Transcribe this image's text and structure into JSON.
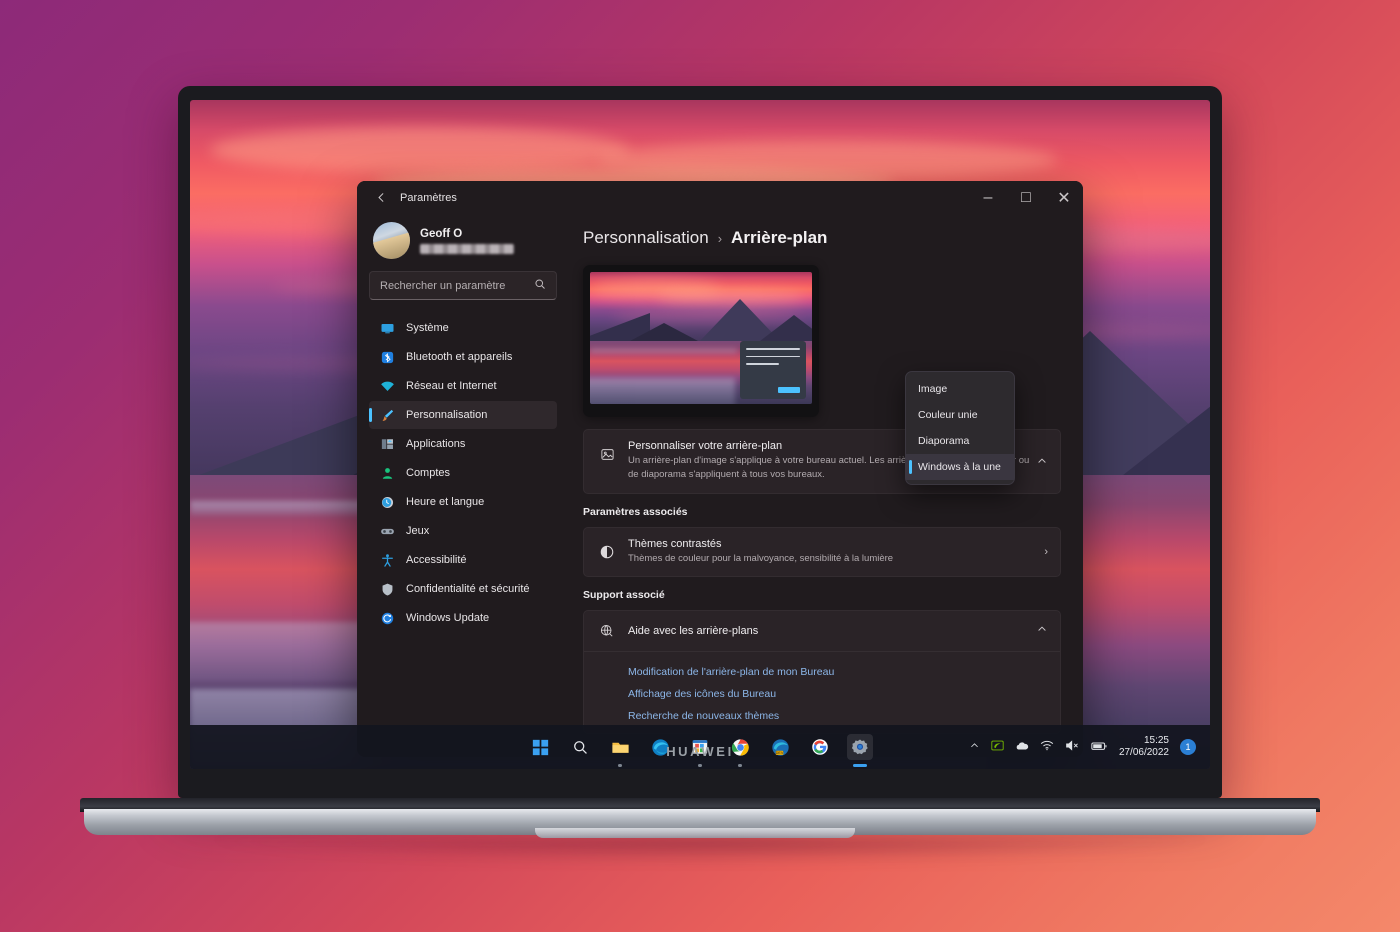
{
  "scene": {
    "device_brand": "HUAWEI",
    "background_gradient": [
      "#8d2a79",
      "#d4495a",
      "#f4886a"
    ]
  },
  "window": {
    "app_title": "Paramètres",
    "back_icon": "back-arrow-icon",
    "controls": {
      "minimize": "–",
      "maximize": "□",
      "close": "✕"
    }
  },
  "sidebar": {
    "profile": {
      "name": "Geoff O",
      "email_redacted": true
    },
    "search": {
      "placeholder": "Rechercher un paramètre",
      "value": "",
      "icon": "search-icon"
    },
    "items": [
      {
        "label": "Système",
        "icon": "monitor-icon",
        "color": "#2d9fe0",
        "selected": false
      },
      {
        "label": "Bluetooth et appareils",
        "icon": "bluetooth-icon",
        "color": "#1f7fe0",
        "selected": false
      },
      {
        "label": "Réseau et Internet",
        "icon": "wifi-icon",
        "color": "#1fb2d8",
        "selected": false
      },
      {
        "label": "Personnalisation",
        "icon": "paintbrush-icon",
        "color": "#4cc2ff",
        "selected": true
      },
      {
        "label": "Applications",
        "icon": "apps-icon",
        "color": "#8fa3b8",
        "selected": false
      },
      {
        "label": "Comptes",
        "icon": "person-icon",
        "color": "#19c37d",
        "selected": false
      },
      {
        "label": "Heure et langue",
        "icon": "clock-icon",
        "color": "#2d9fe0",
        "selected": false
      },
      {
        "label": "Jeux",
        "icon": "gamepad-icon",
        "color": "#9aa4b0",
        "selected": false
      },
      {
        "label": "Accessibilité",
        "icon": "accessibility-icon",
        "color": "#2d9fe0",
        "selected": false
      },
      {
        "label": "Confidentialité et sécurité",
        "icon": "shield-icon",
        "color": "#b8c0c8",
        "selected": false
      },
      {
        "label": "Windows Update",
        "icon": "update-icon",
        "color": "#1f7fe0",
        "selected": false
      }
    ]
  },
  "content": {
    "breadcrumb": {
      "parent": "Personnalisation",
      "separator": "›",
      "current": "Arrière-plan"
    },
    "preview": {
      "name": "desktop-preview-monitor"
    },
    "background_card": {
      "icon": "image-icon",
      "title": "Personnaliser votre arrière-plan",
      "description": "Un arrière-plan d'image s'applique à votre bureau actuel. Les arrière-plans de couleur unifier ou de diaporama s'appliquent à tous vos bureaux.",
      "expand_icon": "chevron-up-icon"
    },
    "dropdown": {
      "open": true,
      "selected": "Windows à la une",
      "options": [
        "Image",
        "Couleur unie",
        "Diaporama",
        "Windows à la une"
      ]
    },
    "related_settings": {
      "label": "Paramètres associés",
      "rows": [
        {
          "icon": "contrast-icon",
          "title": "Thèmes contrastés",
          "subtitle": "Thèmes de couleur pour la malvoyance, sensibilité à la lumière",
          "chevron": "›"
        }
      ]
    },
    "related_support": {
      "label": "Support associé",
      "header": {
        "icon": "globe-help-icon",
        "title": "Aide avec les arrière-plans",
        "expand_icon": "chevron-up-icon"
      },
      "links": [
        "Modification de l'arrière-plan de mon Bureau",
        "Affichage des icônes du Bureau",
        "Recherche de nouveaux thèmes"
      ]
    }
  },
  "taskbar": {
    "icons": [
      {
        "name": "start-icon",
        "label": "Start"
      },
      {
        "name": "search-icon",
        "label": "Recherche"
      },
      {
        "name": "file-explorer-icon",
        "label": "Explorateur de fichiers"
      },
      {
        "name": "edge-icon",
        "label": "Microsoft Edge"
      },
      {
        "name": "store-icon",
        "label": "Microsoft Store"
      },
      {
        "name": "chrome-icon",
        "label": "Google Chrome"
      },
      {
        "name": "edge-dev-icon",
        "label": "Edge Dev"
      },
      {
        "name": "google-icon",
        "label": "Google"
      },
      {
        "name": "settings-icon",
        "label": "Paramètres"
      }
    ],
    "tray": {
      "overflow_icon": "chevron-up-icon",
      "items": [
        "nvidia-icon",
        "onedrive-icon",
        "wifi-icon",
        "volume-muted-icon",
        "battery-icon"
      ],
      "time": "15:25",
      "date": "27/06/2022",
      "notification_count": "1"
    }
  }
}
